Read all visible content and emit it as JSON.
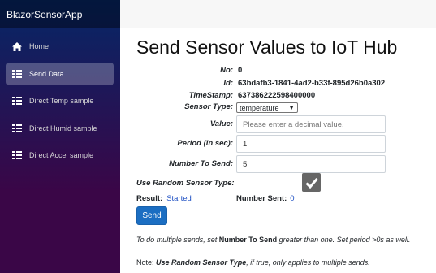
{
  "app": {
    "title": "BlazorSensorApp"
  },
  "nav": [
    {
      "label": "Home",
      "icon": "home-icon"
    },
    {
      "label": "Send Data",
      "icon": "list-icon",
      "active": true
    },
    {
      "label": "Direct Temp sample",
      "icon": "list-icon"
    },
    {
      "label": "Direct Humid sample",
      "icon": "list-icon"
    },
    {
      "label": "Direct Accel sample",
      "icon": "list-icon"
    }
  ],
  "page": {
    "title": "Send Sensor Values to IoT Hub",
    "no_label": "No:",
    "no_value": "0",
    "id_label": "Id:",
    "id_value": "63bdafb3-1841-4ad2-b33f-895d26b0a302",
    "timestamp_label": "TimeStamp:",
    "timestamp_value": "637386222598400000",
    "sensor_type_label": "Sensor Type:",
    "sensor_type_selected": "temperature",
    "value_label": "Value:",
    "value_placeholder": "Please enter a decimal value.",
    "period_label": "Period (in sec):",
    "period_value": "1",
    "number_to_send_label": "Number To Send:",
    "number_to_send_value": "5",
    "use_random_label": "Use Random Sensor Type:",
    "use_random_checked": true,
    "result_label": "Result:",
    "result_value": "Started",
    "number_sent_label": "Number Sent:",
    "number_sent_value": "0",
    "send_button": "Send",
    "help1_a": "To do multiple sends, set ",
    "help1_b": "Number To Send",
    "help1_c": " greater than one. Set period >0s as well.",
    "help2_a": "Note: ",
    "help2_b": "Use Random Sensor Type",
    "help2_c": ", if true, only applies to multiple sends."
  },
  "colors": {
    "accent": "#1b6ec2",
    "link": "#1a4dc2"
  }
}
